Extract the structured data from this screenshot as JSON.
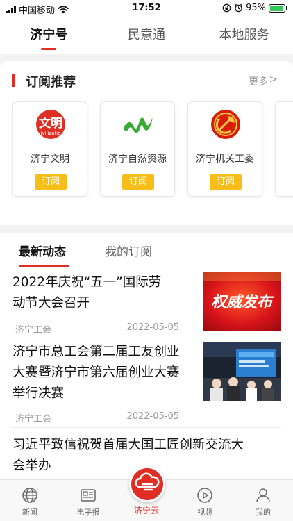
{
  "status_bar": {
    "carrier": "中国移动",
    "time": "17:52",
    "battery": "95%"
  },
  "top_tabs": [
    {
      "label": "济宁号",
      "active": true
    },
    {
      "label": "民意通",
      "active": false
    },
    {
      "label": "本地服务",
      "active": false
    }
  ],
  "subscribe": {
    "title": "订阅推荐",
    "more": "更多",
    "items": [
      {
        "name": "济宁文明",
        "button": "订阅",
        "logo_text": "文明",
        "logo_sub": "ivilizatio"
      },
      {
        "name": "济宁自然资源",
        "button": "订阅"
      },
      {
        "name": "济宁机关工委",
        "button": "订阅"
      }
    ]
  },
  "news_tabs": [
    {
      "label": "最新动态",
      "active": true
    },
    {
      "label": "我的订阅",
      "active": false
    }
  ],
  "feed": [
    {
      "title_line1": "2022年庆祝“五一”国际劳",
      "title_line2": "动节大会召开",
      "source": "济宁工会",
      "date": "2022-05-05",
      "thumb_text": "权威发布"
    },
    {
      "title_line1": "济宁市总工会第二届工友创业",
      "title_line2": "大赛暨济宁市第六届创业大赛",
      "title_line3": "举行决赛",
      "source": "济宁工会",
      "date": "2022-05-05"
    },
    {
      "title_line1": "习近平致信祝贺首届大国工匠创新交流大",
      "title_line2": "会举办"
    }
  ],
  "bottom_nav": [
    {
      "label": "新闻",
      "icon": "globe-icon"
    },
    {
      "label": "电子报",
      "icon": "newspaper-icon"
    },
    {
      "label": "济宁云",
      "icon": "cloud-icon"
    },
    {
      "label": "视频",
      "icon": "play-icon"
    },
    {
      "label": "我的",
      "icon": "user-icon"
    }
  ],
  "colors": {
    "accent": "#e02e24",
    "button": "#f7bd18",
    "battery": "#34c759"
  }
}
